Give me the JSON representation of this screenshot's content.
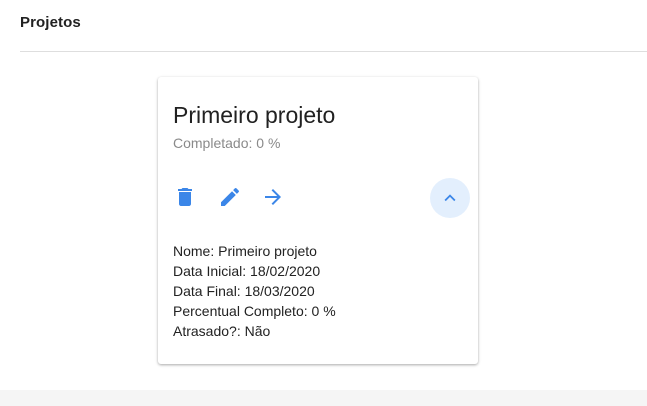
{
  "header": {
    "title": "Projetos"
  },
  "project_card": {
    "title": "Primeiro projeto",
    "subtitle": "Completado: 0 %",
    "actions": {
      "delete_icon": "delete-icon",
      "edit_icon": "edit-pencil-icon",
      "open_icon": "arrow-right-icon",
      "collapse_icon": "chevron-up-icon"
    },
    "details": [
      "Nome: Primeiro projeto",
      "Data Inicial: 18/02/2020",
      "Data Final: 18/03/2020",
      "Percentual Completo: 0 %",
      "Atrasado?: Não"
    ]
  },
  "colors": {
    "accent": "#3b86e8",
    "accent_bg": "#e3effd",
    "subtitle": "#8a8a8a",
    "divider": "#dedede"
  }
}
